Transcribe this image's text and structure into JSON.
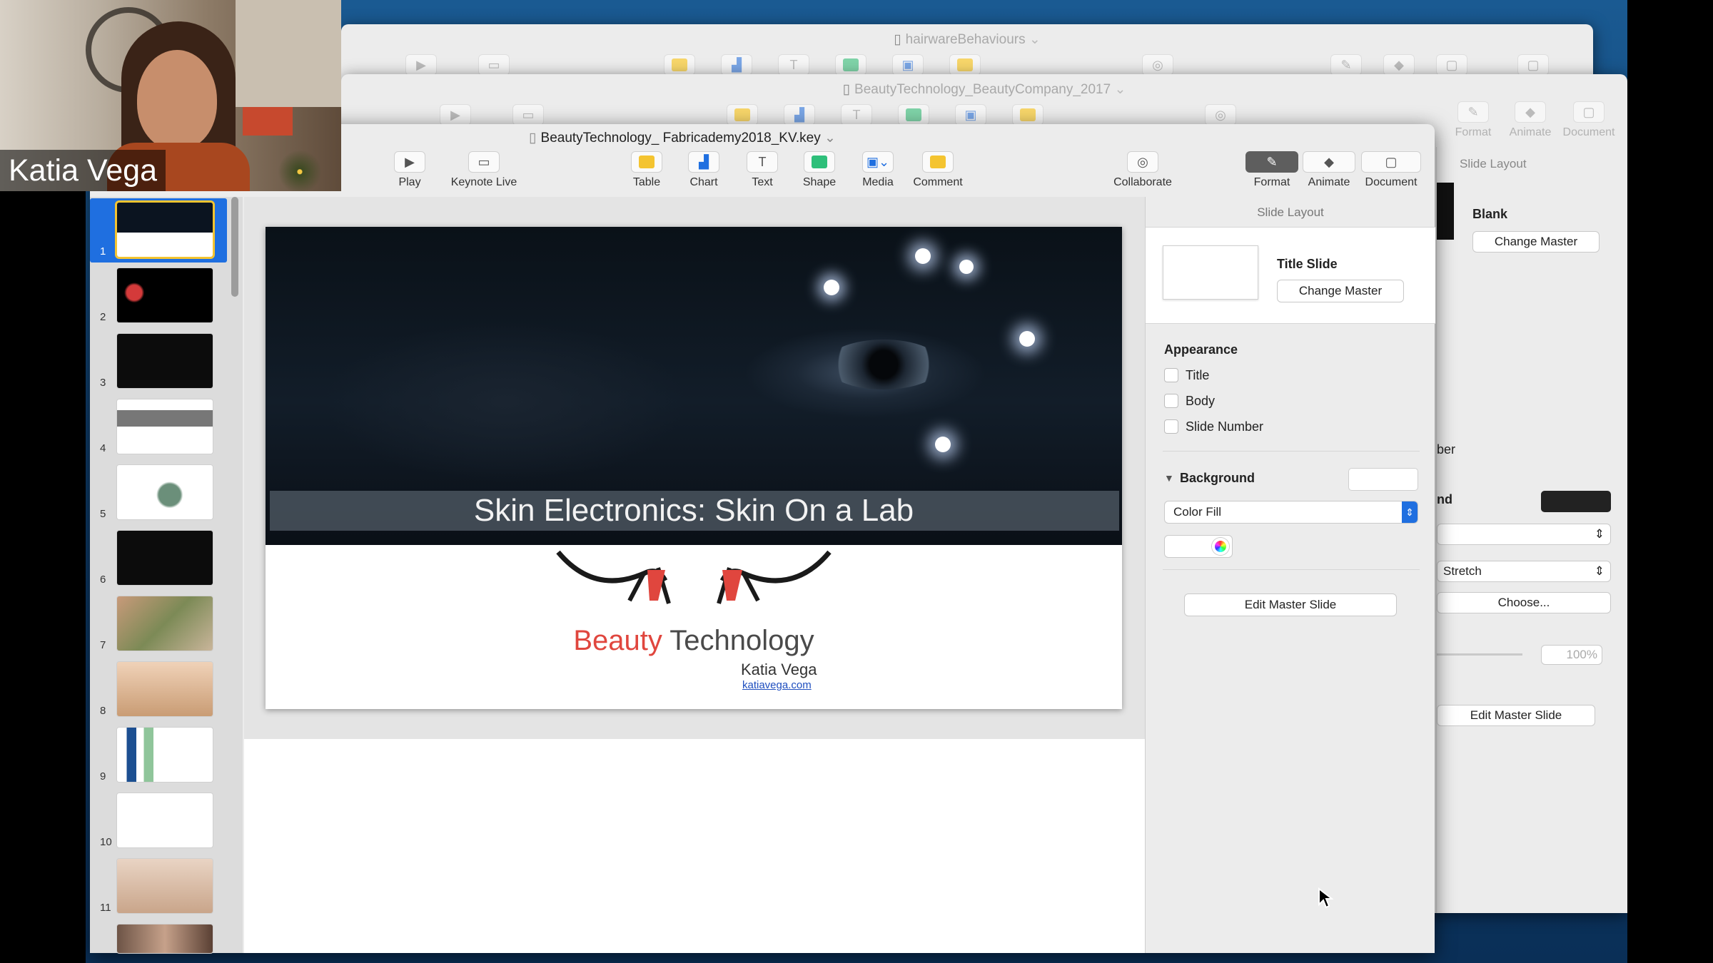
{
  "participant": {
    "name": "Katia Vega"
  },
  "windows": {
    "back": {
      "title": "hairwareBehaviours"
    },
    "middle": {
      "title": "BeautyTechnology_BeautyCompany_2017"
    },
    "front": {
      "title": "BeautyTechnology_ Fabricademy2018_KV.key"
    }
  },
  "toolbar": {
    "play": "Play",
    "keynote_live": "Keynote Live",
    "table": "Table",
    "chart": "Chart",
    "text": "Text",
    "shape": "Shape",
    "media": "Media",
    "comment": "Comment",
    "collaborate": "Collaborate",
    "format": "Format",
    "animate": "Animate",
    "document": "Document"
  },
  "navigator": {
    "selected": 1,
    "slides": [
      "1",
      "2",
      "3",
      "4",
      "5",
      "6",
      "7",
      "8",
      "9",
      "10",
      "11"
    ]
  },
  "slide": {
    "title": "Skin Electronics: Skin On a Lab",
    "brand_red": "Beauty",
    "brand_gray": "Technology",
    "author": "Katia Vega",
    "link": "katiavega.com"
  },
  "inspector": {
    "header": "Slide Layout",
    "layout_name": "Title Slide",
    "change_master": "Change Master",
    "appearance": "Appearance",
    "options": [
      "Title",
      "Body",
      "Slide Number"
    ],
    "background": "Background",
    "fill": "Color Fill",
    "edit_master": "Edit Master Slide"
  },
  "back_inspector": {
    "tabs": [
      "Format",
      "Animate",
      "Document"
    ],
    "header": "Slide Layout",
    "layout_name": "Blank",
    "change_master": "Change Master",
    "partial_number": "ber",
    "partial_background": "nd",
    "scale": "Stretch",
    "choose": "Choose...",
    "opacity": "100%",
    "edit_master": "Edit Master Slide"
  },
  "colors": {
    "brand_red": "#e0463e",
    "accent_blue": "#1f6fe0"
  }
}
